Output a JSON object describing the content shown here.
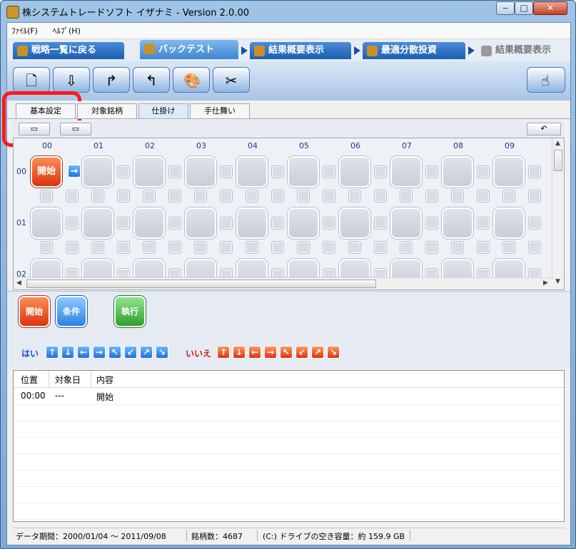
{
  "window": {
    "title": "株システムトレードソフト イザナミ - Version 2.0.00",
    "btn_min": "‒",
    "btn_max": "□",
    "btn_close": "✕"
  },
  "menu": {
    "file": "ﾌｧｲﾙ(F)",
    "help": "ﾍﾙﾌﾟ(H)"
  },
  "nav_tabs": {
    "back": "戦略一覧に戻る",
    "backtest": "バックテスト",
    "results": "結果概要表示",
    "optimize": "最適分散投資",
    "results2": "結果概要表示"
  },
  "sub_tabs": {
    "basic": "基本設定",
    "targets": "対象銘柄",
    "setup": "仕掛け",
    "exit": "手仕舞い"
  },
  "grid": {
    "col_headers": [
      "00",
      "01",
      "02",
      "03",
      "04",
      "05",
      "06",
      "07",
      "08",
      "09"
    ],
    "row_headers": [
      "00",
      "01",
      "02"
    ],
    "start_label": "開始",
    "start_arrow": "→"
  },
  "palette": {
    "start": "開始",
    "condition": "条件",
    "execute": "執行",
    "yes": "はい",
    "no": "いいえ",
    "yes_arrows": [
      "↑",
      "↓",
      "←",
      "→",
      "↖",
      "↙",
      "↗",
      "↘"
    ],
    "no_arrows": [
      "↑",
      "↓",
      "←",
      "→",
      "↖",
      "↙",
      "↗",
      "↘"
    ]
  },
  "list": {
    "headers": {
      "pos": "位置",
      "date": "対象日",
      "content": "内容"
    },
    "rows": [
      {
        "pos": "00:00",
        "date": "---",
        "content": "開始"
      }
    ]
  },
  "status": {
    "period": "データ期間：2000/01/04 ～ 2011/09/08",
    "count": "銘柄数：4687",
    "drive": "(C:) ドライブの空き容量：約 159.9 GB"
  }
}
